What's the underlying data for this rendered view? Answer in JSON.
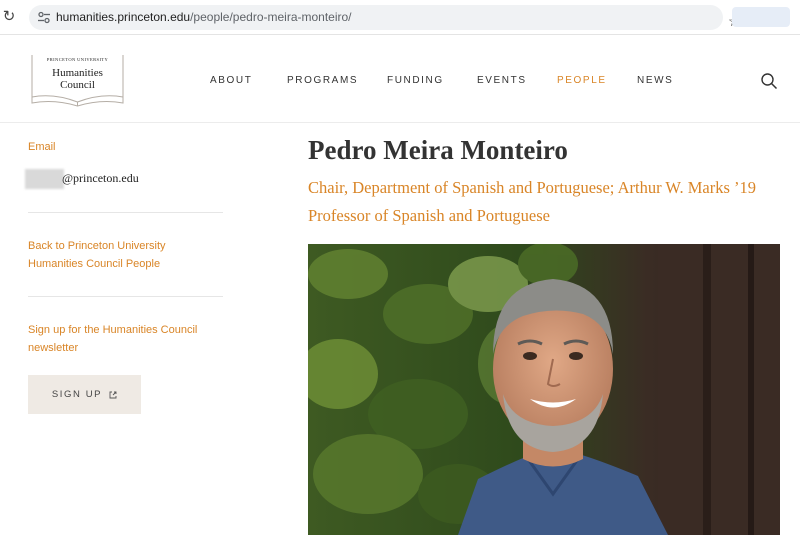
{
  "browser": {
    "url_domain": "humanities.princeton.edu",
    "url_path": "/people/pedro-meira-monteiro/",
    "reload_glyph": "↻",
    "star_glyph": "☆",
    "icons": [
      "reload-icon",
      "site-info-icon",
      "bookmark-star-icon"
    ]
  },
  "header": {
    "logo": {
      "line1": "PRINCETON UNIVERSITY",
      "line2": "Humanities",
      "line3": "Council"
    },
    "nav": [
      {
        "label": "ABOUT"
      },
      {
        "label": "PROGRAMS"
      },
      {
        "label": "FUNDING"
      },
      {
        "label": "EVENTS"
      },
      {
        "label": "PEOPLE",
        "active": true
      },
      {
        "label": "NEWS"
      }
    ],
    "search_icon": "search-icon"
  },
  "sidebar": {
    "email_label": "Email",
    "email_suffix": "@princeton.edu",
    "back_link": "Back to Princeton University Humanities Council People",
    "signup_text": "Sign up for the Humanities Council newsletter",
    "signup_button": "SIGN UP",
    "signup_button_icon": "external-link-icon"
  },
  "profile": {
    "name": "Pedro Meira Monteiro",
    "title": "Chair, Department of Spanish and Portuguese; Arthur W. Marks ’19 Professor of Spanish and Portuguese"
  },
  "colors": {
    "accent": "#d98527",
    "text": "#333333",
    "button_bg": "#efeae4"
  }
}
